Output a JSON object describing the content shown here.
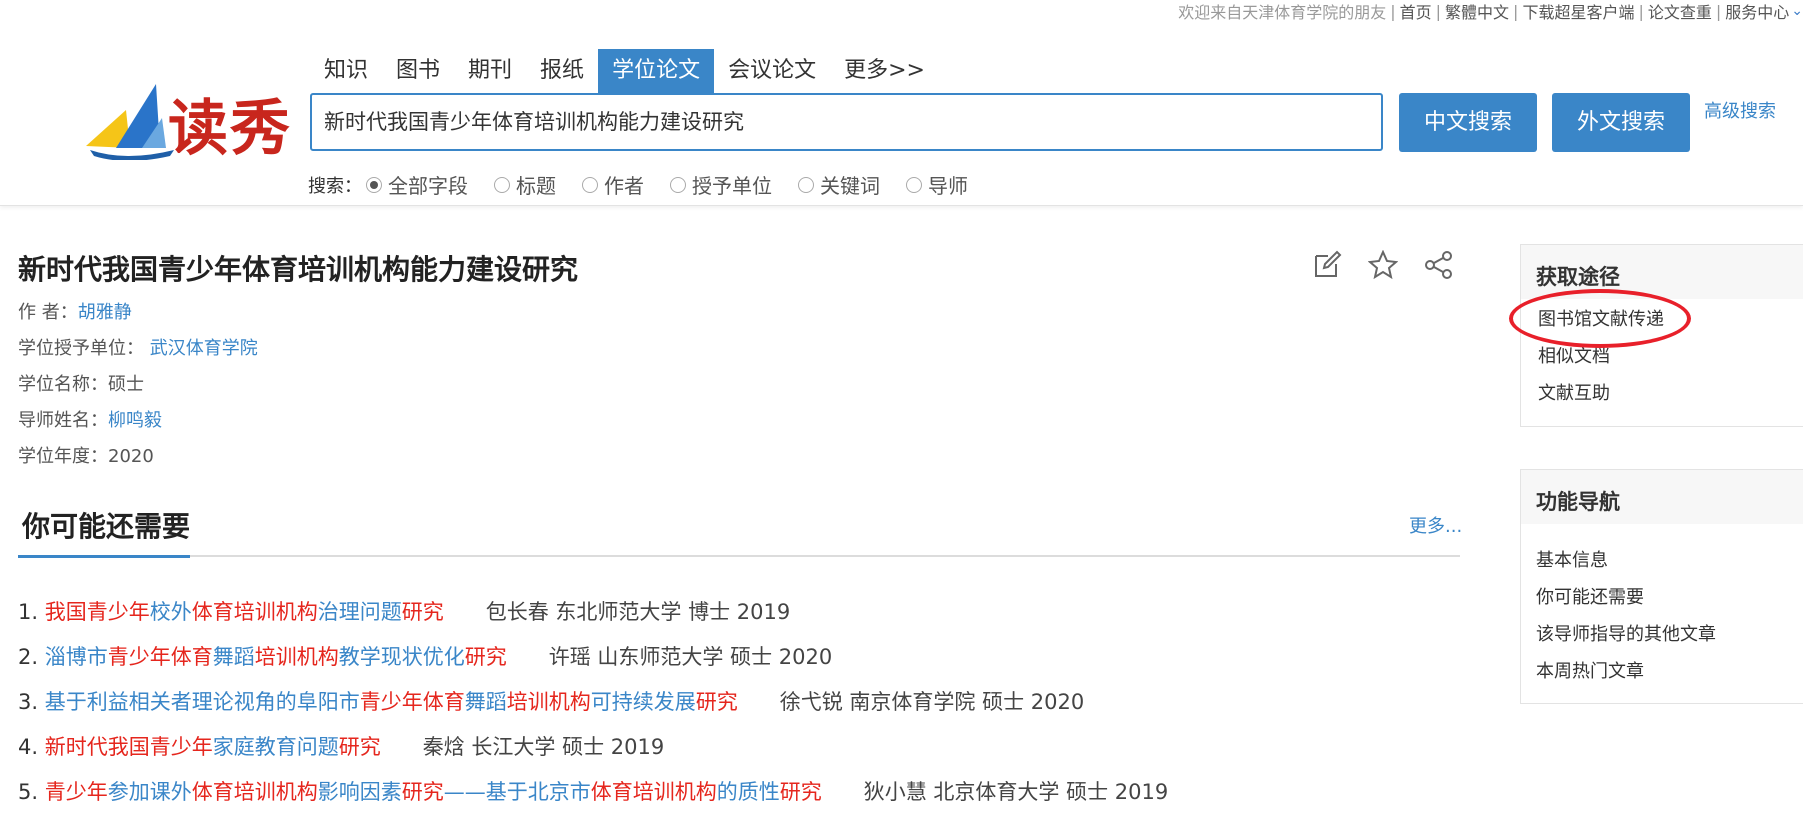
{
  "topbar": {
    "welcome": "欢迎来自天津体育学院的朋友",
    "links": [
      "首页",
      "繁體中文",
      "下载超星客户端",
      "论文查重",
      "服务中心"
    ]
  },
  "logo": {
    "text": "读秀"
  },
  "tabs": [
    {
      "label": "知识",
      "active": false
    },
    {
      "label": "图书",
      "active": false
    },
    {
      "label": "期刊",
      "active": false
    },
    {
      "label": "报纸",
      "active": false
    },
    {
      "label": "学位论文",
      "active": true
    },
    {
      "label": "会议论文",
      "active": false
    },
    {
      "label": "更多>>",
      "active": false
    }
  ],
  "search": {
    "value": "新时代我国青少年体育培训机构能力建设研究",
    "cn_button": "中文搜索",
    "en_button": "外文搜索",
    "advanced": "高级搜索",
    "scope_label": "搜索：",
    "scopes": [
      "全部字段",
      "标题",
      "作者",
      "授予单位",
      "关键词",
      "导师"
    ],
    "selected_scope": "全部字段"
  },
  "paper": {
    "title": "新时代我国青少年体育培训机构能力建设研究",
    "author_label": "作 者：",
    "author": "胡雅静",
    "unit_label": "学位授予单位：",
    "unit": "武汉体育学院",
    "degree_label": "学位名称：",
    "degree": "硕士",
    "advisor_label": "导师姓名：",
    "advisor": "柳鸣毅",
    "year_label": "学位年度：",
    "year": "2020"
  },
  "related": {
    "title": "你可能还需要",
    "more": "更多...",
    "items": [
      {
        "num": "1.",
        "parts": [
          [
            "r",
            "我国"
          ],
          [
            "r",
            "青少年"
          ],
          [
            "b",
            "校外"
          ],
          [
            "r",
            "体育培训机构"
          ],
          [
            "b",
            "治理问题"
          ],
          [
            "r",
            "研究"
          ]
        ],
        "info": "包长春 东北师范大学 博士 2019"
      },
      {
        "num": "2.",
        "parts": [
          [
            "b",
            "淄博市"
          ],
          [
            "r",
            "青少年体育"
          ],
          [
            "b",
            "舞蹈"
          ],
          [
            "r",
            "培训机构"
          ],
          [
            "b",
            "教学现状优化"
          ],
          [
            "r",
            "研究"
          ]
        ],
        "info": "许瑶 山东师范大学 硕士 2020"
      },
      {
        "num": "3.",
        "parts": [
          [
            "b",
            "基于利益相关者理论视角的阜阳市"
          ],
          [
            "r",
            "青少年体育"
          ],
          [
            "b",
            "舞蹈"
          ],
          [
            "r",
            "培训机构"
          ],
          [
            "b",
            "可持续发展"
          ],
          [
            "r",
            "研究"
          ]
        ],
        "info": "徐弋锐 南京体育学院 硕士 2020"
      },
      {
        "num": "4.",
        "parts": [
          [
            "r",
            "新时代我国青少年"
          ],
          [
            "b",
            "家庭教育问题"
          ],
          [
            "r",
            "研究"
          ]
        ],
        "info": "秦焓 长江大学 硕士 2019"
      },
      {
        "num": "5.",
        "parts": [
          [
            "r",
            "青少年"
          ],
          [
            "b",
            "参加课外"
          ],
          [
            "r",
            "体育培训机构"
          ],
          [
            "b",
            "影响因素"
          ],
          [
            "r",
            "研究"
          ],
          [
            "b",
            "——基于北京市"
          ],
          [
            "r",
            "体育培训机构"
          ],
          [
            "b",
            "的质性"
          ],
          [
            "r",
            "研究"
          ]
        ],
        "info": "狄小慧 北京体育大学 硕士 2019"
      }
    ]
  },
  "access": {
    "title": "获取途径",
    "items": [
      "图书馆文献传递",
      "相似文档",
      "文献互助"
    ]
  },
  "nav": {
    "title": "功能导航",
    "items": [
      "基本信息",
      "你可能还需要",
      "该导师指导的其他文章",
      "本周热门文章"
    ]
  },
  "icons": [
    "edit-icon",
    "star-icon",
    "share-icon"
  ],
  "colors": {
    "accent": "#3a86c8",
    "highlight": "#e5261d",
    "annotation": "#e8202a"
  }
}
